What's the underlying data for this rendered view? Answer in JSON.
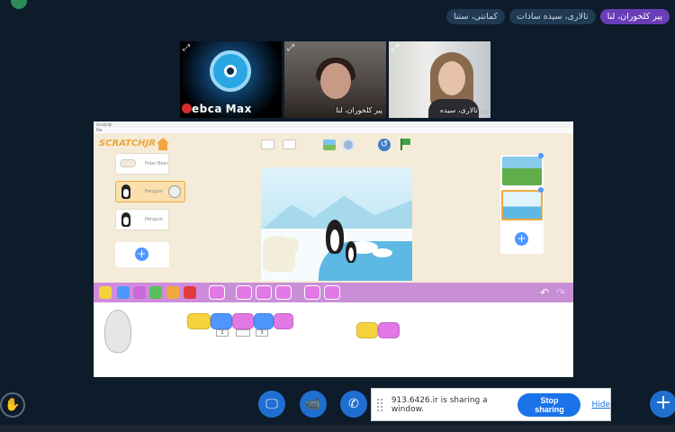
{
  "participants": [
    {
      "name": "پیر کلخوران، لنا",
      "active": true
    },
    {
      "name": "تالاری، سیده سادات",
      "active": false
    },
    {
      "name": "کمانتی، ستنا",
      "active": false
    }
  ],
  "videos": [
    {
      "label": "WebcamMax",
      "brand_left": "ebca",
      "brand_right": "Max"
    },
    {
      "label": "پیر کلخوران، لنا"
    },
    {
      "label": "تالاری، سیده ..."
    }
  ],
  "shared_window": {
    "title": "ScratchJr",
    "menu": "File",
    "app_logo": "SCRATCHJR",
    "sprites": [
      {
        "label": "Polar Bear"
      },
      {
        "label": "Penguin"
      },
      {
        "label": "Penguin"
      }
    ],
    "add_label": "+",
    "numbers": [
      "2",
      "",
      "3"
    ]
  },
  "controls": {
    "hand": "✋",
    "screen": "🖵",
    "camera": "📹",
    "phone": "✆",
    "plus": "+"
  },
  "share": {
    "text": "913.6426.ir is sharing a window.",
    "stop": "Stop sharing",
    "hide": "Hide"
  },
  "colors": {
    "accent": "#1a73e8",
    "active_tag": "#6a3db8",
    "palette": "#cf8bdc"
  }
}
